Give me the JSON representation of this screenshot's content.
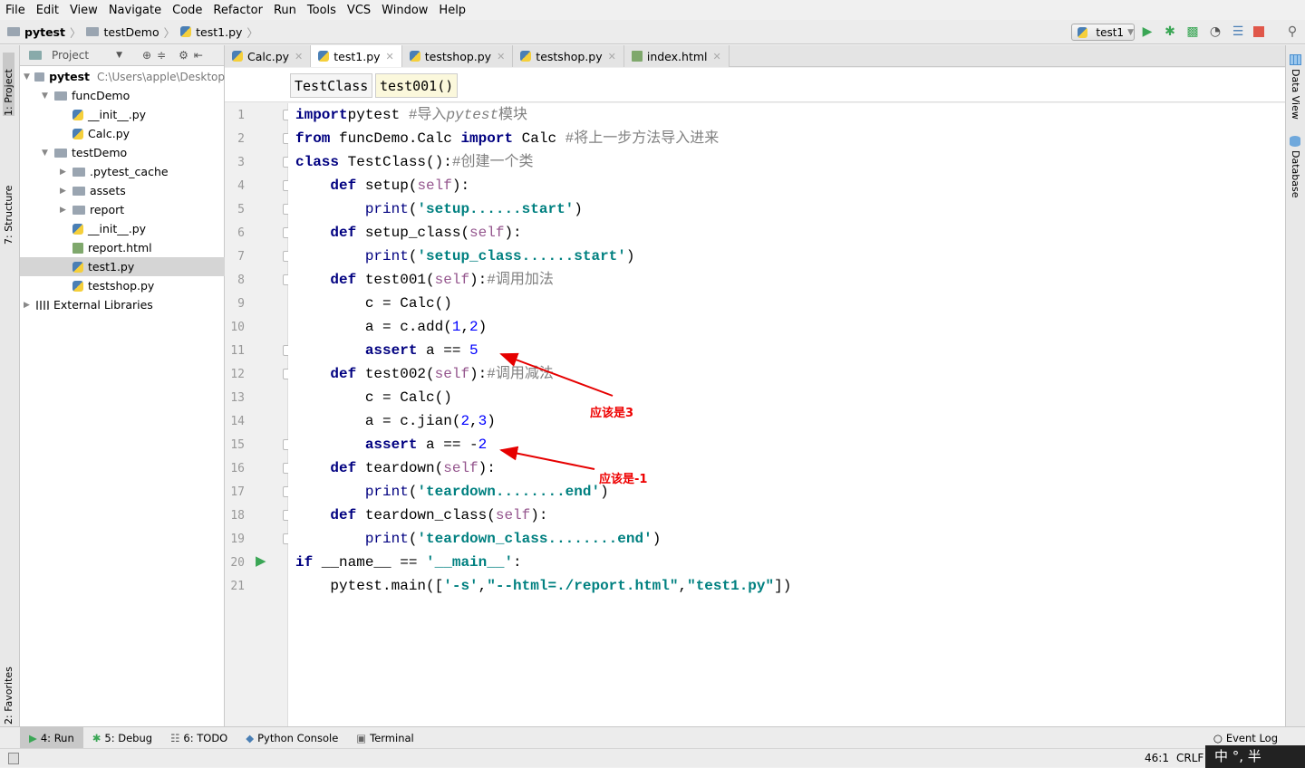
{
  "menu": [
    "File",
    "Edit",
    "View",
    "Navigate",
    "Code",
    "Refactor",
    "Run",
    "Tools",
    "VCS",
    "Window",
    "Help"
  ],
  "breadcrumb": [
    "pytest",
    "testDemo",
    "test1.py"
  ],
  "run_config": "test1",
  "toolbar_icons": [
    "run-icon",
    "debug-icon",
    "coverage-icon",
    "profile-icon",
    "concurrency-icon",
    "stop-icon",
    "search-icon"
  ],
  "left_tabs": [
    "1: Project",
    "7: Structure",
    "2: Favorites"
  ],
  "right_tabs": [
    "Data View",
    "Database"
  ],
  "project": {
    "header": "Project",
    "tree": [
      {
        "label": "pytest",
        "extra": "C:\\Users\\apple\\Desktop",
        "type": "folder",
        "depth": 0,
        "arrow": "down",
        "bold": true
      },
      {
        "label": "funcDemo",
        "type": "folder",
        "depth": 1,
        "arrow": "down"
      },
      {
        "label": "__init__.py",
        "type": "py",
        "depth": 2
      },
      {
        "label": "Calc.py",
        "type": "py",
        "depth": 2
      },
      {
        "label": "testDemo",
        "type": "folder",
        "depth": 1,
        "arrow": "down"
      },
      {
        "label": ".pytest_cache",
        "type": "folder",
        "depth": 2,
        "arrow": "right"
      },
      {
        "label": "assets",
        "type": "folder",
        "depth": 2,
        "arrow": "right"
      },
      {
        "label": "report",
        "type": "folder",
        "depth": 2,
        "arrow": "right"
      },
      {
        "label": "__init__.py",
        "type": "py",
        "depth": 2
      },
      {
        "label": "report.html",
        "type": "html",
        "depth": 2
      },
      {
        "label": "test1.py",
        "type": "py",
        "depth": 2,
        "selected": true
      },
      {
        "label": "testshop.py",
        "type": "py",
        "depth": 2
      },
      {
        "label": "External Libraries",
        "type": "lib",
        "depth": 0,
        "arrow": "right"
      }
    ]
  },
  "tabs": [
    {
      "label": "Calc.py",
      "type": "py"
    },
    {
      "label": "test1.py",
      "type": "py",
      "active": true
    },
    {
      "label": "testshop.py",
      "type": "py"
    },
    {
      "label": "testshop.py",
      "type": "py"
    },
    {
      "label": "index.html",
      "type": "html"
    }
  ],
  "code_breadcrumb": [
    "TestClass",
    "test001()"
  ],
  "code": [
    [
      [
        "kw",
        "import"
      ],
      [
        "",
        "pytest "
      ],
      [
        "cm",
        "#导入"
      ],
      [
        "cmi",
        "pytest"
      ],
      [
        "cm",
        "模块"
      ]
    ],
    [
      [
        "kw",
        "from"
      ],
      [
        "",
        " funcDemo.Calc "
      ],
      [
        "kw",
        "import"
      ],
      [
        "",
        " Calc "
      ],
      [
        "cm",
        "#将上一步方法导入进来"
      ]
    ],
    [
      [
        "kw",
        "class"
      ],
      [
        "",
        " TestClass():"
      ],
      [
        "cm",
        "#创建一个类"
      ]
    ],
    [
      [
        "",
        "    "
      ],
      [
        "kw",
        "def"
      ],
      [
        "",
        " setup("
      ],
      [
        "sf",
        "self"
      ],
      [
        "",
        "):"
      ]
    ],
    [
      [
        "",
        "        "
      ],
      [
        "bi",
        "print"
      ],
      [
        "",
        "("
      ],
      [
        "st",
        "'setup......start'"
      ],
      [
        "",
        ")"
      ]
    ],
    [
      [
        "",
        "    "
      ],
      [
        "kw",
        "def"
      ],
      [
        "",
        " setup_class("
      ],
      [
        "sf",
        "self"
      ],
      [
        "",
        "):"
      ]
    ],
    [
      [
        "",
        "        "
      ],
      [
        "bi",
        "print"
      ],
      [
        "",
        "("
      ],
      [
        "st",
        "'setup_class......start'"
      ],
      [
        "",
        ")"
      ]
    ],
    [
      [
        "",
        "    "
      ],
      [
        "kw",
        "def"
      ],
      [
        "",
        " test001("
      ],
      [
        "sf",
        "self"
      ],
      [
        "",
        "):"
      ],
      [
        "cm",
        "#调用加法"
      ]
    ],
    [
      [
        "",
        "        c = Calc()"
      ]
    ],
    [
      [
        "",
        "        a = c.add("
      ],
      [
        "nm",
        "1"
      ],
      [
        "",
        ","
      ],
      [
        "nm",
        "2"
      ],
      [
        "",
        ")"
      ]
    ],
    [
      [
        "",
        "        "
      ],
      [
        "kw",
        "assert"
      ],
      [
        "",
        " a == "
      ],
      [
        "nm",
        "5"
      ]
    ],
    [
      [
        "",
        "    "
      ],
      [
        "kw",
        "def"
      ],
      [
        "",
        " test002("
      ],
      [
        "sf",
        "self"
      ],
      [
        "",
        "):"
      ],
      [
        "cm",
        "#调用减法"
      ]
    ],
    [
      [
        "",
        "        c = Calc()"
      ]
    ],
    [
      [
        "",
        "        a = c.jian("
      ],
      [
        "nm",
        "2"
      ],
      [
        "",
        ","
      ],
      [
        "nm",
        "3"
      ],
      [
        "",
        ")"
      ]
    ],
    [
      [
        "",
        "        "
      ],
      [
        "kw",
        "assert"
      ],
      [
        "",
        " a == -"
      ],
      [
        "nm",
        "2"
      ]
    ],
    [
      [
        "",
        "    "
      ],
      [
        "kw",
        "def"
      ],
      [
        "",
        " teardown("
      ],
      [
        "sf",
        "self"
      ],
      [
        "",
        "):"
      ]
    ],
    [
      [
        "",
        "        "
      ],
      [
        "bi",
        "print"
      ],
      [
        "",
        "("
      ],
      [
        "st",
        "'teardown........end'"
      ],
      [
        "",
        ")"
      ]
    ],
    [
      [
        "",
        "    "
      ],
      [
        "kw",
        "def"
      ],
      [
        "",
        " teardown_class("
      ],
      [
        "sf",
        "self"
      ],
      [
        "",
        "):"
      ]
    ],
    [
      [
        "",
        "        "
      ],
      [
        "bi",
        "print"
      ],
      [
        "",
        "("
      ],
      [
        "st",
        "'teardown_class........end'"
      ],
      [
        "",
        ")"
      ]
    ],
    [
      [
        "kw",
        "if"
      ],
      [
        "",
        " __name__ == "
      ],
      [
        "st",
        "'__main__'"
      ],
      [
        "",
        ":"
      ]
    ],
    [
      [
        "",
        "    pytest.main(["
      ],
      [
        "st",
        "'-s'"
      ],
      [
        "",
        ","
      ],
      [
        "st",
        "\"--html=./report.html\""
      ],
      [
        "",
        ","
      ],
      [
        "st",
        "\"test1.py\""
      ],
      [
        "",
        "])"
      ]
    ]
  ],
  "current_line": 11,
  "annotations": [
    "应该是3",
    "应该是-1"
  ],
  "annotation_color": "#e60000",
  "bottom_tools": [
    {
      "label": "4: Run",
      "icon": "run-icon",
      "active": true
    },
    {
      "label": "5: Debug",
      "icon": "debug-icon"
    },
    {
      "label": "6: TODO",
      "icon": "todo-icon"
    },
    {
      "label": "Python Console",
      "icon": "python-icon"
    },
    {
      "label": "Terminal",
      "icon": "terminal-icon"
    }
  ],
  "event_log": "Event Log",
  "status": {
    "position": "46:1",
    "line_sep": "CRLF",
    "ime": "中 °, 半"
  }
}
